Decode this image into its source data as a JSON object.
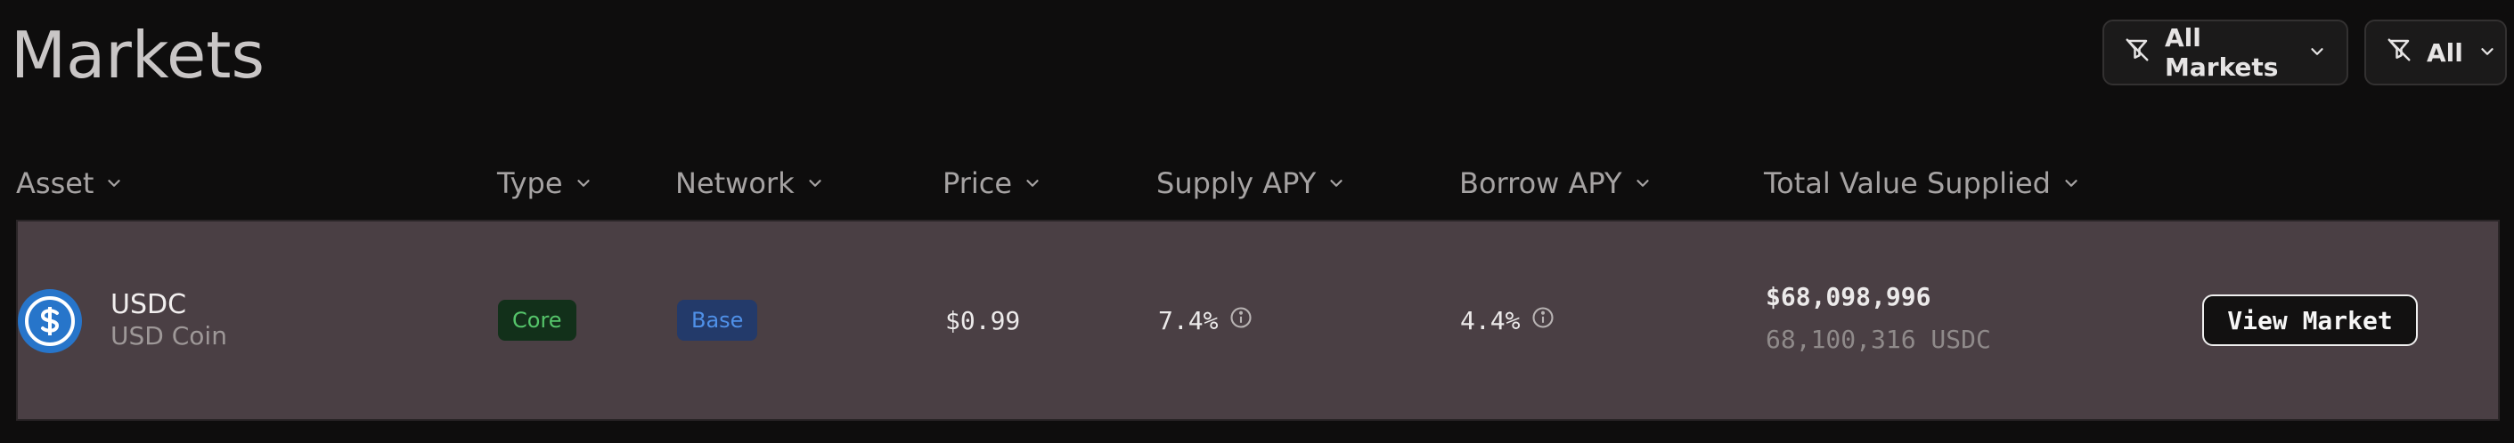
{
  "header": {
    "title": "Markets",
    "filters": [
      {
        "label": "All Markets",
        "icon": "filter-off-icon"
      },
      {
        "label": "All",
        "icon": "filter-off-icon"
      }
    ]
  },
  "table": {
    "columns": [
      "Asset",
      "Type",
      "Network",
      "Price",
      "Supply APY",
      "Borrow APY",
      "Total Value Supplied"
    ],
    "rows": [
      {
        "asset_symbol": "USDC",
        "asset_name": "USD Coin",
        "type": "Core",
        "network": "Base",
        "price": "$0.99",
        "supply_apy": "7.4%",
        "borrow_apy": "4.4%",
        "tvs_usd": "$68,098,996",
        "tvs_token": "68,100,316 USDC",
        "action_label": "View Market"
      }
    ]
  },
  "colors": {
    "background": "#0e0d0d",
    "row_background": "#4a3f44",
    "usdc_brand": "#2775ca",
    "core_badge_text": "#55c46a",
    "base_badge_text": "#4f90e8"
  }
}
